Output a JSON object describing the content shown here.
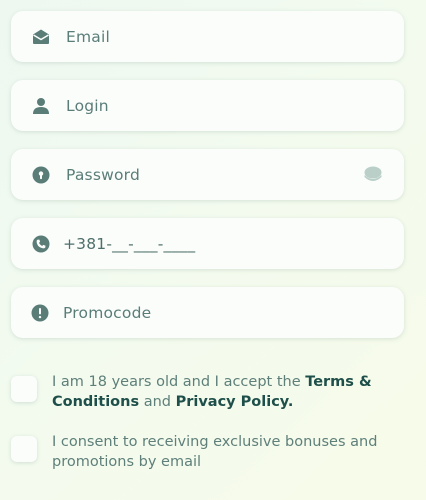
{
  "fields": {
    "email": {
      "placeholder": "Email",
      "icon": "envelope-icon"
    },
    "login": {
      "placeholder": "Login",
      "icon": "user-icon"
    },
    "password": {
      "placeholder": "Password",
      "icon": "lock-icon",
      "toggle_icon": "eye-toggle-icon"
    },
    "phone": {
      "value": "+381-__-___-____",
      "icon": "phone-icon"
    },
    "promocode": {
      "placeholder": "Promocode",
      "icon": "info-circle-icon"
    }
  },
  "consents": {
    "age_terms": {
      "text_before": "I am 18 years old and I accept the ",
      "terms_link": "Terms & Conditions",
      "text_middle": " and ",
      "privacy_link": "Privacy Policy.",
      "checked": false
    },
    "marketing": {
      "text": "I consent to receiving exclusive bonuses and promotions by email",
      "checked": false
    }
  },
  "colors": {
    "icon": "#5a7d78",
    "text": "#5e7f7a",
    "link": "#1f4f4a",
    "field_bg": "#fbfdfb"
  }
}
